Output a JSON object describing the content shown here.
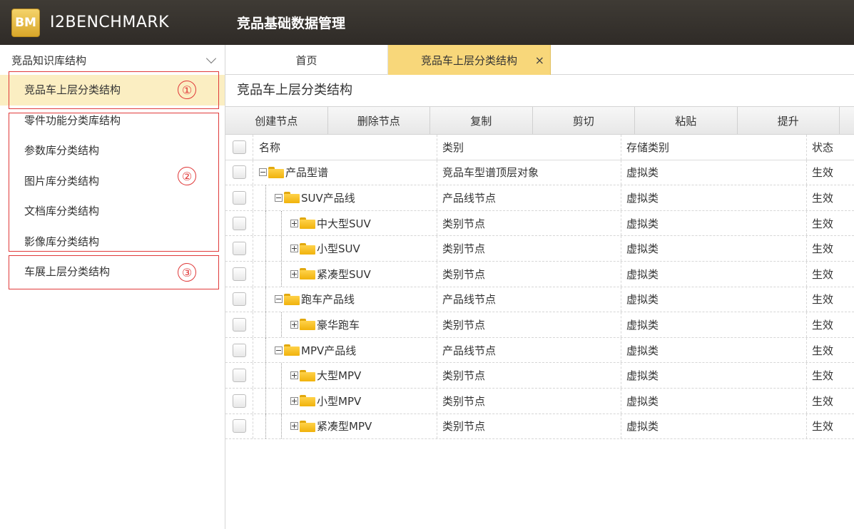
{
  "header": {
    "logo_text": "BM",
    "brand": "I2BENCHMARK",
    "app_title": "竞品基础数据管理"
  },
  "sidebar": {
    "title": "竞品知识库结构",
    "items": [
      {
        "label": "竞品车上层分类结构",
        "active": true
      },
      {
        "label": "零件功能分类库结构"
      },
      {
        "label": "参数库分类结构"
      },
      {
        "label": "图片库分类结构"
      },
      {
        "label": "文档库分类结构"
      },
      {
        "label": "影像库分类结构"
      },
      {
        "label": "车展上层分类结构"
      }
    ],
    "annotations": [
      "①",
      "②",
      "③"
    ]
  },
  "tabs": [
    {
      "label": "首页"
    },
    {
      "label": "竞品车上层分类结构",
      "active": true,
      "close": "×"
    }
  ],
  "section_title": "竞品车上层分类结构",
  "toolbar": [
    "创建节点",
    "删除节点",
    "复制",
    "剪切",
    "粘贴",
    "提升"
  ],
  "grid": {
    "columns": [
      "名称",
      "类别",
      "存储类别",
      "状态"
    ],
    "rows": [
      {
        "name": "产品型谱",
        "level": 0,
        "toggle": "minus",
        "type": "竞品车型谱顶层对象",
        "storage": "虚拟类",
        "status": "生效"
      },
      {
        "name": "SUV产品线",
        "level": 1,
        "toggle": "minus",
        "type": "产品线节点",
        "storage": "虚拟类",
        "status": "生效"
      },
      {
        "name": "中大型SUV",
        "level": 2,
        "toggle": "plus",
        "type": "类别节点",
        "storage": "虚拟类",
        "status": "生效"
      },
      {
        "name": "小型SUV",
        "level": 2,
        "toggle": "plus",
        "type": "类别节点",
        "storage": "虚拟类",
        "status": "生效"
      },
      {
        "name": "紧凑型SUV",
        "level": 2,
        "toggle": "plus",
        "type": "类别节点",
        "storage": "虚拟类",
        "status": "生效"
      },
      {
        "name": "跑车产品线",
        "level": 1,
        "toggle": "minus",
        "type": "产品线节点",
        "storage": "虚拟类",
        "status": "生效"
      },
      {
        "name": "豪华跑车",
        "level": 2,
        "toggle": "plus",
        "type": "类别节点",
        "storage": "虚拟类",
        "status": "生效"
      },
      {
        "name": "MPV产品线",
        "level": 1,
        "toggle": "minus",
        "type": "产品线节点",
        "storage": "虚拟类",
        "status": "生效"
      },
      {
        "name": "大型MPV",
        "level": 2,
        "toggle": "plus",
        "type": "类别节点",
        "storage": "虚拟类",
        "status": "生效"
      },
      {
        "name": "小型MPV",
        "level": 2,
        "toggle": "plus",
        "type": "类别节点",
        "storage": "虚拟类",
        "status": "生效"
      },
      {
        "name": "紧凑型MPV",
        "level": 2,
        "toggle": "plus",
        "type": "类别节点",
        "storage": "虚拟类",
        "status": "生效"
      }
    ]
  },
  "icons": {
    "folder": "folder-icon",
    "collapse": "chevron-down-icon",
    "checkbox": "checkbox-icon"
  },
  "colors": {
    "topbar": "#2f2b27",
    "accent": "#f8d77a",
    "active_item": "#fbeec2",
    "annotation": "#e03a3a"
  }
}
